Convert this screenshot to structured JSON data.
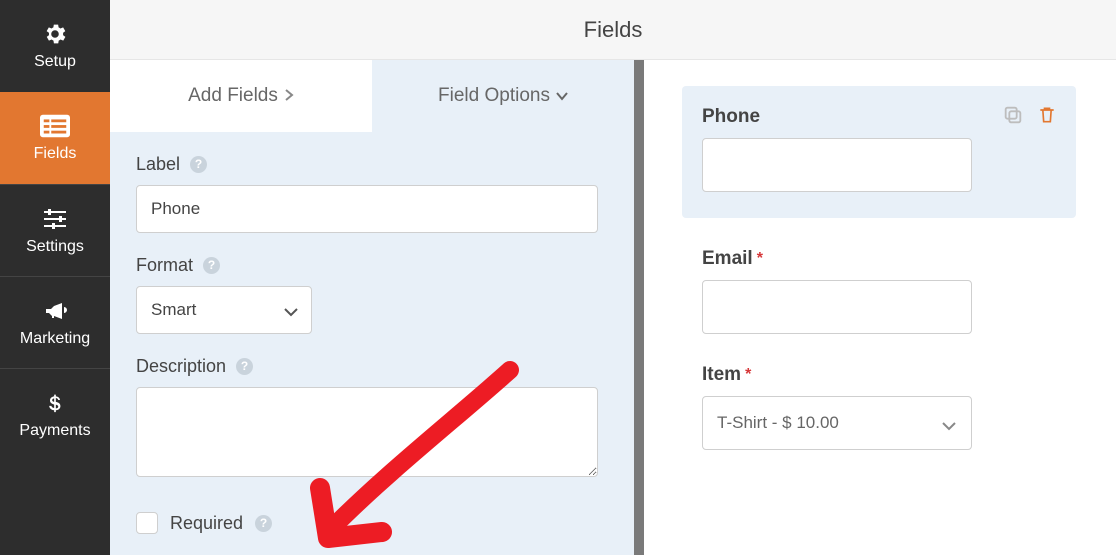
{
  "sidenav": {
    "items": [
      {
        "label": "Setup",
        "icon": "gear-icon"
      },
      {
        "label": "Fields",
        "icon": "fields-icon",
        "active": true
      },
      {
        "label": "Settings",
        "icon": "sliders-icon"
      },
      {
        "label": "Marketing",
        "icon": "bullhorn-icon"
      },
      {
        "label": "Payments",
        "icon": "dollar-icon"
      }
    ]
  },
  "topbar": {
    "title": "Fields"
  },
  "panel_tabs": {
    "add_fields": "Add Fields",
    "field_options": "Field Options"
  },
  "field_options": {
    "label_caption": "Label",
    "label_value": "Phone",
    "format_caption": "Format",
    "format_value": "Smart",
    "description_caption": "Description",
    "description_value": "",
    "required_caption": "Required",
    "required_checked": false
  },
  "preview": {
    "fields": [
      {
        "label": "Phone",
        "required": false,
        "type": "text",
        "selected": true
      },
      {
        "label": "Email",
        "required": true,
        "type": "text"
      },
      {
        "label": "Item",
        "required": true,
        "type": "select",
        "value": "T-Shirt - $ 10.00"
      }
    ]
  }
}
